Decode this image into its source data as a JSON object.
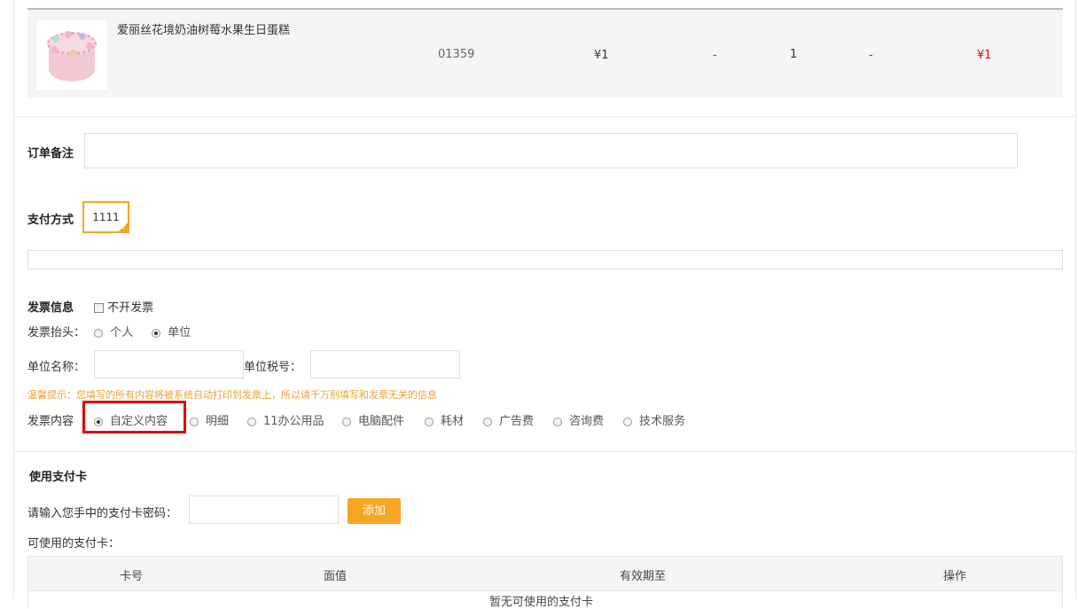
{
  "product": {
    "name": "爱丽丝花境奶油树莓水果生日蛋糕",
    "code": "01359",
    "price": "¥1",
    "dash1": "-",
    "quantity": "1",
    "dash2": "-",
    "subtotal": "¥1"
  },
  "remark": {
    "label": "订单备注",
    "value": ""
  },
  "payment": {
    "label": "支付方式",
    "selected": "1111"
  },
  "invoice": {
    "label": "发票信息",
    "no_invoice_label": "不开发票",
    "header_label": "发票抬头：",
    "header_options": [
      "个人",
      "单位"
    ],
    "company_name_label": "单位名称：",
    "tax_no_label": "单位税号：",
    "tip": "温馨提示：您填写的所有内容将被系统自动打印到发票上，所以请千万别填写和发票无关的信息",
    "content_label": "发票内容",
    "content_options": [
      "自定义内容",
      "明细",
      "11办公用品",
      "电脑配件",
      "耗材",
      "广告费",
      "咨询费",
      "技术服务"
    ]
  },
  "card": {
    "title": "使用支付卡",
    "input_label": "请输入您手中的支付卡密码：",
    "add_label": "添加",
    "available_label": "可使用的支付卡：",
    "columns": [
      "卡号",
      "面值",
      "有效期至",
      "操作"
    ],
    "empty": "暂无可使用的支付卡"
  },
  "colors": {
    "accent": "#f5a623",
    "price_red": "#e30000",
    "tip": "#e6a23c"
  }
}
